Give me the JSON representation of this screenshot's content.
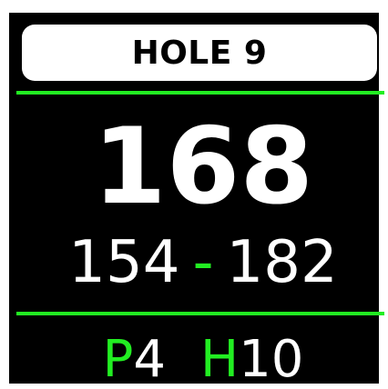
{
  "header": {
    "hole_label": "HOLE 9"
  },
  "distances": {
    "center": "168",
    "front": "154",
    "separator": "-",
    "back": "182"
  },
  "hole_info": {
    "par_letter": "P",
    "par_value": "4",
    "handicap_letter": "H",
    "handicap_value": "10"
  },
  "colors": {
    "accent": "#22ee22",
    "background": "#000000",
    "text": "#ffffff",
    "banner": "#ffffff",
    "banner_text": "#000000"
  }
}
